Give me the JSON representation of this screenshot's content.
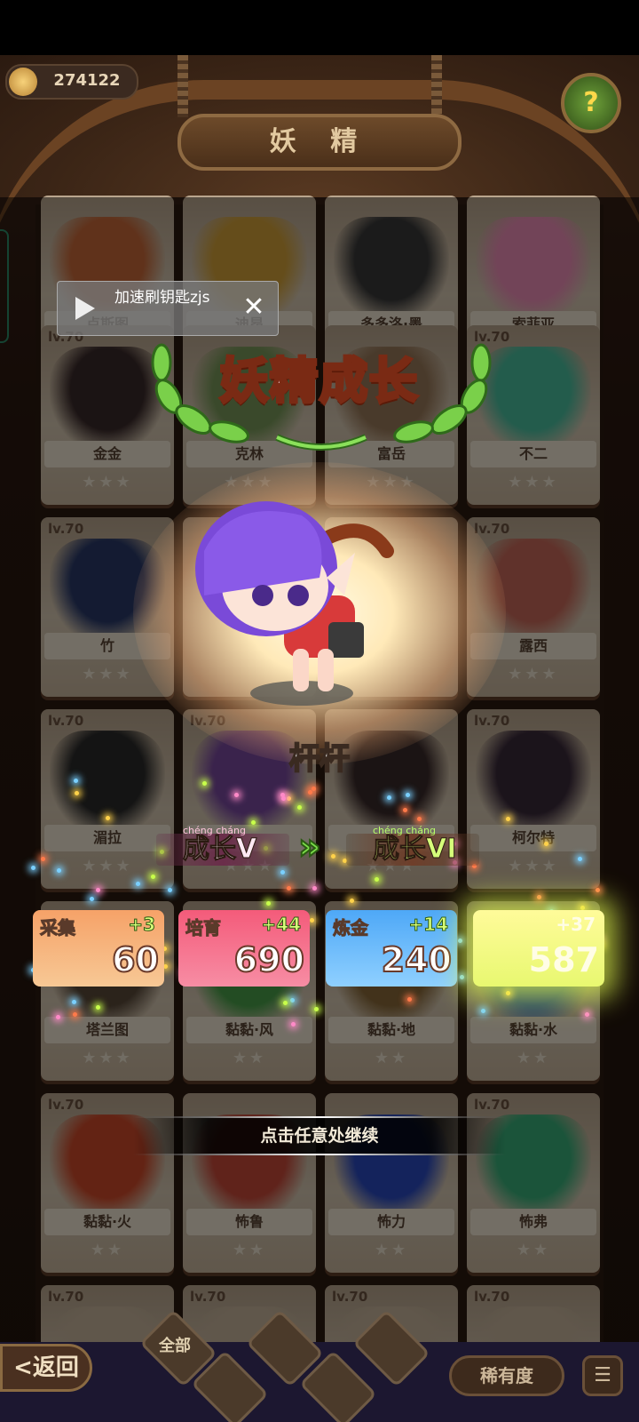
{
  "header": {
    "coins": "274122",
    "title": "妖 精",
    "help_icon": "question-icon"
  },
  "cards": [
    {
      "name": "卢斯图",
      "level": "",
      "stars": "★★★",
      "color": "#c86a3a"
    },
    {
      "name": "迪昂",
      "level": "",
      "stars": "★★★",
      "color": "#d4a23a"
    },
    {
      "name": "多多洛·墨",
      "level": "",
      "stars": "★★★",
      "color": "#3a3a3a"
    },
    {
      "name": "索菲亚",
      "level": "",
      "stars": "★★★",
      "color": "#ef8fb8"
    },
    {
      "name": "金金",
      "level": "lv.70",
      "stars": "★★★",
      "color": "#3a2a2a"
    },
    {
      "name": "克林",
      "level": "",
      "stars": "★★★",
      "color": "#7a9a5a"
    },
    {
      "name": "富岳",
      "level": "",
      "stars": "★★★",
      "color": "#9a7a5a"
    },
    {
      "name": "不二",
      "level": "lv.70",
      "stars": "★★★",
      "color": "#4ac0a0"
    },
    {
      "name": "竹",
      "level": "lv.70",
      "stars": "★★★",
      "color": "#2a3a6a"
    },
    {
      "name": "",
      "level": "",
      "stars": "",
      "color": "#c9b79e"
    },
    {
      "name": "",
      "level": "",
      "stars": "",
      "color": "#c9b79e"
    },
    {
      "name": "露西",
      "level": "lv.70",
      "stars": "★★★",
      "color": "#c86a5a"
    },
    {
      "name": "湄拉",
      "level": "lv.70",
      "stars": "★★★",
      "color": "#2a2a2a"
    },
    {
      "name": "",
      "level": "lv.70",
      "stars": "★★★",
      "color": "#7a4aa0"
    },
    {
      "name": "",
      "level": "",
      "stars": "★★★",
      "color": "#3a2a2a"
    },
    {
      "name": "柯尔特",
      "level": "lv.70",
      "stars": "★★★",
      "color": "#3a2a3a"
    },
    {
      "name": "塔兰图",
      "level": "",
      "stars": "★★★",
      "color": "#5a4a3a"
    },
    {
      "name": "黏黏·风",
      "level": "",
      "stars": "★★",
      "color": "#4aa04a"
    },
    {
      "name": "黏黏·地",
      "level": "",
      "stars": "★★",
      "color": "#8a6a3a"
    },
    {
      "name": "黏黏·水",
      "level": "",
      "stars": "★★",
      "color": "#3a7ad0"
    },
    {
      "name": "黏黏·火",
      "level": "lv.70",
      "stars": "★★",
      "color": "#d04a2a"
    },
    {
      "name": "怖鲁",
      "level": "",
      "stars": "★★",
      "color": "#c84a3a"
    },
    {
      "name": "怖力",
      "level": "",
      "stars": "★★",
      "color": "#2a4ac0"
    },
    {
      "name": "怖弗",
      "level": "lv.70",
      "stars": "★★",
      "color": "#3ab07a"
    },
    {
      "name": "",
      "level": "lv.70",
      "stars": "",
      "color": "#c9b79e"
    },
    {
      "name": "",
      "level": "lv.70",
      "stars": "",
      "color": "#c9b79e"
    },
    {
      "name": "",
      "level": "lv.70",
      "stars": "",
      "color": "#c9b79e"
    },
    {
      "name": "",
      "level": "lv.70",
      "stars": "",
      "color": "#c9b79e"
    }
  ],
  "ad_popup": {
    "text": "加速刷钥匙zjs",
    "play_icon": "play-icon",
    "close_label": "✕"
  },
  "modal": {
    "title": "妖精成长",
    "hero_name": "杆杆",
    "growth_from": "成长V",
    "growth_to": "成长VI",
    "growth_pinyin": "chéng cháng",
    "arrow": "»",
    "continue_hint": "点击任意处继续",
    "stats": [
      {
        "label": "采集",
        "increase": "+3",
        "value": "60"
      },
      {
        "label": "培育",
        "increase": "+44",
        "value": "690"
      },
      {
        "label": "炼金",
        "increase": "+14",
        "value": "240"
      },
      {
        "label": "",
        "increase": "+37",
        "value": "587"
      }
    ]
  },
  "footer": {
    "back_label": "<返回",
    "all_label": "全部",
    "rarity_label": "稀有度",
    "menu_icon": "list-icon"
  }
}
